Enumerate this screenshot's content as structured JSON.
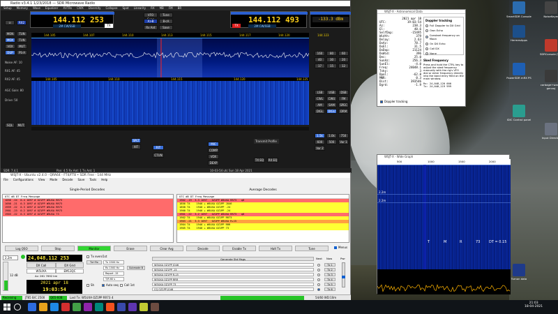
{
  "powersdr": {
    "title": "Radio v3.4.1 1/23/2018 — SDR Microwave Radio",
    "menu": [
      "Setup",
      "Memory",
      "Wave",
      "Equalizer",
      "XVTRs",
      "CWX",
      "Diversity",
      "Collapse",
      "Spot",
      "Linearity",
      "RX",
      "MB",
      "FM",
      "BR"
    ],
    "vfo_a_freq": "144.112 253",
    "vfo_b_freq": "144.112 493",
    "vfo_a_band": "2M CW/SSB",
    "vfo_b_band": "2M CW/SSB",
    "signal_level": "-133.3 dBm",
    "rx_label": "RX",
    "tx_label": "TX",
    "left_buttons": [
      "MON",
      "TUN",
      "MOX",
      "TUN",
      "VOX",
      "MUT",
      "DUP",
      "PS-A"
    ],
    "pan_ticks": [
      "144.105",
      "144.107",
      "144.110",
      "144.113",
      "144.115",
      "144.117",
      "144.120",
      "144.123"
    ],
    "wf_ticks": [
      "144.105",
      "144.110",
      "144.115",
      "144.120",
      "144.125"
    ],
    "mode_buttons": [
      "LSB",
      "USB",
      "DSB",
      "CWL",
      "CWU",
      "FM",
      "AM",
      "SAM",
      "SPEC",
      "DIGL",
      "DIGU",
      "DRM"
    ],
    "band_buttons": [
      "160",
      "80",
      "60",
      "40",
      "30",
      "20",
      "17",
      "15",
      "12",
      "10",
      "6",
      "2",
      "GEN"
    ],
    "filter_buttons": [
      "1.5k",
      "1.0k",
      "750",
      "600",
      "500",
      "Var 1",
      "Var 2"
    ],
    "status_left": "SDR: 7.4.1",
    "status_mid": "10-03-54 utc   Sun 18 Apr 2021",
    "status_right": "Pan: 4.5  Rx Ant: 1  Tx Ant: 1"
  },
  "wsjt": {
    "title": "WSJT-X - Ubuntu v2.4.0 - QRA64 - FT4/FT8 • SDR Free   - 144 MHz",
    "menu": [
      "File",
      "Configurations",
      "View",
      "Mode",
      "Decode",
      "Save",
      "Tools",
      "Help"
    ],
    "left_pane_title": "Single-Period Decodes",
    "right_pane_title": "Average Decodes",
    "header": "UTC   dB   DT Freq    Message",
    "left_rows": [
      {
        "text": "1056 -24  0.4 1097 # OZ1PP W5UXA RR73",
        "color": "red"
      },
      {
        "text": "1058 -21  0.3 1097 # OZ1PP W5UXA RR73",
        "color": "red"
      },
      {
        "text": "1959 -22  0.3 1097 # OZ1PP W5UXA RR73",
        "color": "red"
      },
      {
        "text": "1901 -23  0.2 1097 # OZ1PP W5UXA RR73",
        "color": "red"
      },
      {
        "text": "1903 -22  0.3 1097 # OZ1PP W5UXA 73",
        "color": "red"
      }
    ],
    "right_rows": [
      {
        "text": "1902 -19  3.3 1097   OZ1PP W5UXA RR73   q0",
        "color": "red"
      },
      {
        "text": "1856 T4    1946 + W5UXA OZ1PP JO46",
        "color": "yellow"
      },
      {
        "text": "1858 T4    1946 + W5UXA OZ1PP -24",
        "color": "yellow"
      },
      {
        "text": "1900 T4    1946 + W5UXA OZ1PP -24",
        "color": "yellow"
      },
      {
        "text": "1901 -22  3.2 1097   OZ1PP W5UXA RR73   q0",
        "color": "red"
      },
      {
        "text": "1902 T4    1946 + W5UXA OZ1PP RR73",
        "color": "yellow"
      },
      {
        "text": "1903 -21  3.3 1097   OZ1PP W5UXA R+15",
        "color": "orange"
      },
      {
        "text": "1904 T4    1946 + W5UXA OZ1PP RRR",
        "color": "yellow"
      },
      {
        "text": "1905 T4    1946 + W5UXA OZ1PP 73",
        "color": "yellow"
      }
    ],
    "buttons": [
      "Log QSO",
      "Stop",
      "Monitor",
      "Erase",
      "Clear Avg",
      "Decode",
      "Enable Tx",
      "Halt Tx",
      "Tune"
    ],
    "menus_label": "Menus",
    "band": "2.2m",
    "dial_freq": "24,048,112 253",
    "dx_call_label": "DX Call",
    "dx_grid_label": "DX Grid",
    "dx_call": "W5UXA",
    "dx_grid": "EM13QC",
    "az_dist": "Az: 261   7692 km",
    "lookup": "Lookup",
    "add": "Add",
    "date": "2021 apr 18",
    "time": "19:03:54",
    "tx_even": "Tx even/1st",
    "tx_hz": "Tx 1500 Hz",
    "rx_hz": "Rx 1500 Hz",
    "report": "Report -15",
    "sh": "Sh",
    "auto_seq": "Auto seq",
    "call_1st": "Call 1st",
    "gen_std_msgs": "Generate Std Msgs",
    "next_label": "Next",
    "now_label": "Now",
    "pwr_label": "Pwr",
    "tx_messages": [
      "W5UXA OZ1PP JO46",
      "W5UXA OZ1PP -15",
      "W5UXA OZ1PP R-15",
      "W5UXA OZ1PP RRR",
      "W5UXA OZ1PP 73",
      "CQ OZ1PP JO46"
    ],
    "tx_buttons": [
      "Tx 1",
      "Tx 2",
      "Tx 3",
      "Tx 4",
      "Tx 5",
      "Tx 6"
    ],
    "db_value": "12 dB",
    "status_receiving": "Receiving",
    "status_mode": "JT65 B/C 2500",
    "status_q65": "Q65-60B",
    "status_last_tx": "Last Tx: W5UXA OZ1PP RR73",
    "status_num": "4",
    "status_right": "54/60  WD:10m"
  },
  "astro": {
    "title": "WSJT-X - Astronomical Data",
    "rows": [
      [
        "",
        "2021 apr 18"
      ],
      [
        "UTC:",
        "19:03:54"
      ],
      [
        "Az:",
        "238.3"
      ],
      [
        "El:",
        "40.6"
      ],
      [
        "SelfDop:",
        "-15495"
      ],
      [
        "Width:",
        "379"
      ],
      [
        "Delay:",
        "2.63"
      ],
      [
        "DxAz:",
        "78.7"
      ],
      [
        "DxEl:",
        "31.5"
      ],
      [
        "DxDop:",
        "21124"
      ],
      [
        "DxWid:",
        "396"
      ],
      [
        "Dec:",
        "25.0"
      ],
      [
        "SunAz:",
        "256.3"
      ],
      [
        "SunEl:",
        "-4.0"
      ],
      [
        "Freq:",
        "24048.1"
      ],
      [
        "Tsky:",
        "3"
      ],
      [
        "Dpol:",
        "-62.8"
      ],
      [
        "MNR:",
        "0.3"
      ],
      [
        "Dist:",
        "393546"
      ],
      [
        "Dgrd:",
        "-1.9"
      ]
    ],
    "doppler_title": "Doppler tracking",
    "doppler_opts": [
      "Full Doppler to DX Grid",
      "Own Echo",
      "Constant frequency on Moon",
      "On DX Echo",
      "Call DX",
      "None"
    ],
    "doppler_selected": 2,
    "dial_title": "Sked Frequency",
    "dial_note": "Press and hold the CTRL key to adjust the sked frequency manually with the rig's VFO dial or enter frequency directly into the band entry field on the main window.",
    "rx_line": "Rx: 24,048,120 000",
    "tx_line": "Tx: 24,048,119 999",
    "doppler_check": "Doppler tracking"
  },
  "widegraph": {
    "title": "WSJT-X - Wide Graph",
    "scale_ticks": [
      "500",
      "1000",
      "1500",
      "2000"
    ],
    "band_label": "2.2m",
    "marks": [
      "T",
      "M",
      "R",
      "73"
    ],
    "dt_label": "DT = 0.15"
  },
  "desktop_icons": [
    {
      "label": "SmartSDR Console",
      "color": "#2b6cb0"
    },
    {
      "label": "NoiseKeyer",
      "color": "#444"
    },
    {
      "label": "HermesApps",
      "color": "#1c4f8a"
    },
    {
      "label": "SDRConsole (V3)",
      "color": "#c0392b"
    },
    {
      "label": "PowerSDR mRX PS",
      "color": "#1e5fb4"
    },
    {
      "label": "carbage+ware - genvoj",
      "color": "#3a3a3a"
    },
    {
      "label": "IDIC Control panel",
      "color": "#2a9d8f"
    },
    {
      "label": "Input Director",
      "color": "#6b7280"
    },
    {
      "label": "Turnon data",
      "color": "#1e3a8a"
    }
  ],
  "taskbar": {
    "time": "21:03",
    "date": "18-04-2021"
  }
}
